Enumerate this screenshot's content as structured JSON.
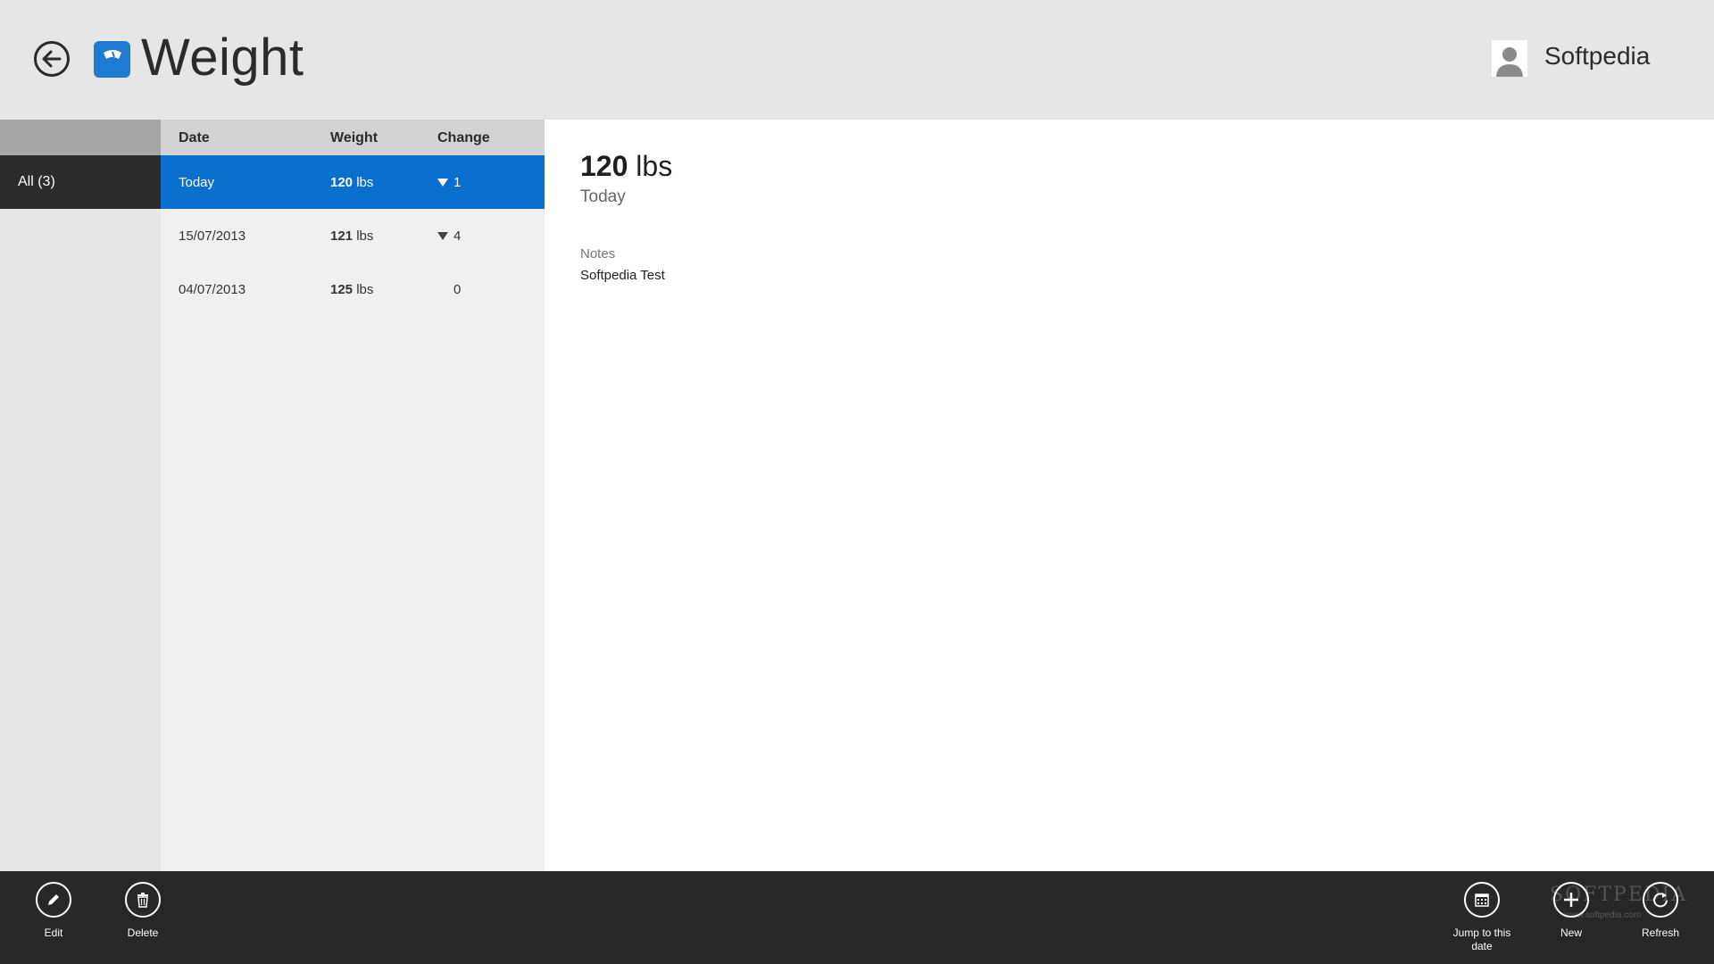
{
  "header": {
    "title": "Weight",
    "user_name": "Softpedia"
  },
  "filter": {
    "items": [
      {
        "label": "All (3)"
      }
    ]
  },
  "list": {
    "columns": {
      "date": "Date",
      "weight": "Weight",
      "change": "Change"
    },
    "rows": [
      {
        "date": "Today",
        "weight_value": "120",
        "weight_unit": "lbs",
        "change": "1",
        "direction": "down",
        "selected": true
      },
      {
        "date": "15/07/2013",
        "weight_value": "121",
        "weight_unit": "lbs",
        "change": "4",
        "direction": "down",
        "selected": false
      },
      {
        "date": "04/07/2013",
        "weight_value": "125",
        "weight_unit": "lbs",
        "change": "0",
        "direction": "none",
        "selected": false
      }
    ]
  },
  "detail": {
    "weight_value": "120",
    "weight_unit": "lbs",
    "date": "Today",
    "notes_label": "Notes",
    "notes": "Softpedia Test"
  },
  "appbar": {
    "edit": "Edit",
    "delete": "Delete",
    "jump": "Jump to this date",
    "new": "New",
    "refresh": "Refresh",
    "watermark": "SOFTPEDIA",
    "watermark_url": "www.softpedia.com"
  },
  "colors": {
    "accent": "#0a6fcf",
    "app_icon": "#1e7bd1",
    "appbar": "#272727"
  }
}
